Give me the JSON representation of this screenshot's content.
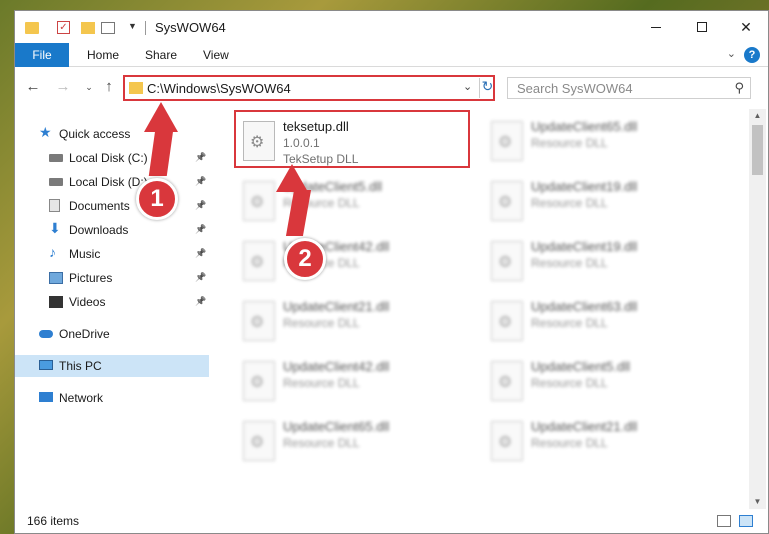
{
  "window": {
    "title": "SysWOW64",
    "controls": {
      "minimize": "",
      "maximize": "",
      "close": "✕"
    }
  },
  "ribbon": {
    "tabs": [
      "File",
      "Home",
      "Share",
      "View"
    ],
    "help": "?"
  },
  "address": {
    "path": "C:\\Windows\\SysWOW64",
    "search_placeholder": "Search SysWOW64"
  },
  "navpane": {
    "items": [
      {
        "label": "Quick access",
        "icon": "star-icon",
        "pinned": false
      },
      {
        "label": "Local Disk (C:)",
        "icon": "disk-icon",
        "pinned": true
      },
      {
        "label": "Local Disk (D:)",
        "icon": "disk-icon",
        "pinned": true
      },
      {
        "label": "Documents",
        "icon": "document-icon",
        "pinned": true
      },
      {
        "label": "Downloads",
        "icon": "download-icon",
        "pinned": true
      },
      {
        "label": "Music",
        "icon": "music-icon",
        "pinned": true
      },
      {
        "label": "Pictures",
        "icon": "picture-icon",
        "pinned": true
      },
      {
        "label": "Videos",
        "icon": "video-icon",
        "pinned": true
      },
      {
        "label": "OneDrive",
        "icon": "cloud-icon",
        "pinned": false
      },
      {
        "label": "This PC",
        "icon": "computer-icon",
        "pinned": false,
        "selected": true
      },
      {
        "label": "Network",
        "icon": "network-icon",
        "pinned": false
      }
    ]
  },
  "files": [
    {
      "name": "teksetup.dll",
      "version": "1.0.0.1",
      "description": "TekSetup DLL",
      "highlighted": true
    },
    {
      "name": "UpdateClient65.dll",
      "description": "Resource DLL"
    },
    {
      "name": "UpdateClient5.dll",
      "description": "Resource DLL"
    },
    {
      "name": "UpdateClient19.dll",
      "description": "Resource DLL"
    },
    {
      "name": "UpdateClient42.dll",
      "description": "Resource DLL"
    },
    {
      "name": "UpdateClient19.dll",
      "description": "Resource DLL"
    },
    {
      "name": "UpdateClient21.dll",
      "description": "Resource DLL"
    },
    {
      "name": "UpdateClient63.dll",
      "description": "Resource DLL"
    },
    {
      "name": "UpdateClient42.dll",
      "description": "Resource DLL"
    },
    {
      "name": "UpdateClient5.dll",
      "description": "Resource DLL"
    },
    {
      "name": "UpdateClient65.dll",
      "description": "Resource DLL"
    },
    {
      "name": "UpdateClient21.dll",
      "description": "Resource DLL"
    }
  ],
  "status": {
    "item_count": "166 items"
  },
  "annotations": {
    "badge1": "1",
    "badge2": "2"
  },
  "colors": {
    "accent": "#1979ca",
    "annotation_red": "#d9373c",
    "selection": "#cce4f7"
  }
}
